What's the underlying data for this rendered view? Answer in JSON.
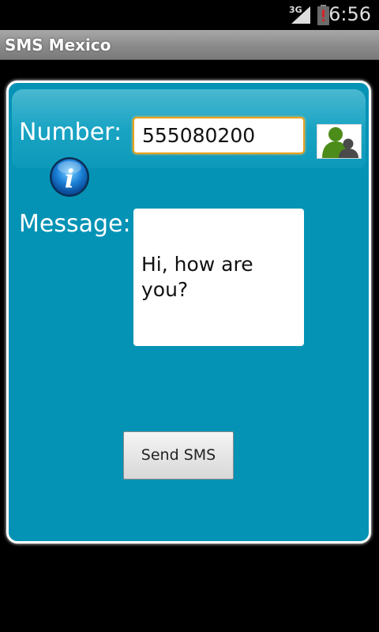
{
  "status_bar": {
    "network": "3G",
    "time": "6:56",
    "icons": [
      "signal-icon",
      "battery-alert-icon"
    ]
  },
  "app": {
    "title": "SMS Mexico"
  },
  "form": {
    "number_label": "Number:",
    "number_value": "555080200",
    "message_label": "Message:",
    "message_value": "Hi, how are\nyou?",
    "send_label": "Send SMS",
    "icons": [
      "contacts-icon",
      "info-icon"
    ]
  },
  "colors": {
    "panel": "#0593b5",
    "input_focus_border": "#e8a21b",
    "contact_green": "#4c8c1a"
  }
}
